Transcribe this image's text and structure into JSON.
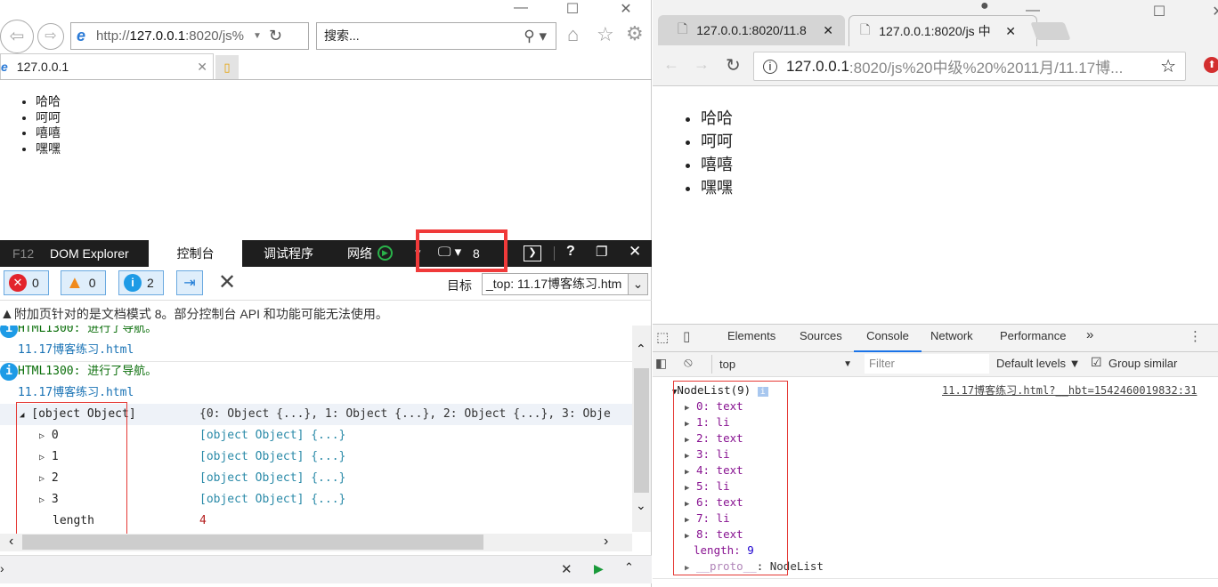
{
  "ie": {
    "window_controls": {
      "minimize": "—",
      "maximize": "☐",
      "close": "✕"
    },
    "address": {
      "prefix": "http://",
      "host": "127.0.0.1",
      "rest": ":8020/js%"
    },
    "search_placeholder": "搜索...",
    "tab_title": "127.0.0.1",
    "page_list": [
      "哈哈",
      "呵呵",
      "嘻嘻",
      "嘿嘿"
    ],
    "devtools": {
      "tabs": [
        "F12",
        "DOM Explorer",
        "控制台",
        "调试程序",
        "网络"
      ],
      "active_tab": "控制台",
      "doc_mode": "8",
      "counts": {
        "errors": "0",
        "warnings": "0",
        "info": "2"
      },
      "target_label": "目标",
      "target_value": "_top: 11.17博客练习.htm",
      "warning_text": "附加页针对的是文档模式 8。部分控制台 API 和功能可能无法使用。",
      "messages": [
        {
          "code": "HTML1300: 进行了导航。",
          "file": "11.17博客练习.html"
        },
        {
          "code": "HTML1300: 进行了导航。",
          "file": "11.17博客练习.html"
        }
      ],
      "object": {
        "label": "[object Object]",
        "summary_prefix": "{0: ",
        "summary": "{0: Object {...}, 1: Object {...}, 2: Object {...}, 3: Obje",
        "children": [
          {
            "key": "0",
            "value": "[object Object] {...}"
          },
          {
            "key": "1",
            "value": "[object Object] {...}"
          },
          {
            "key": "2",
            "value": "[object Object] {...}"
          },
          {
            "key": "3",
            "value": "[object Object] {...}"
          }
        ],
        "length_key": "length",
        "length_value": "4"
      }
    }
  },
  "chrome": {
    "tabs": [
      {
        "title": "127.0.0.1:8020/11.8"
      },
      {
        "title": "127.0.0.1:8020/js 中"
      }
    ],
    "address": {
      "host": "127.0.0.1",
      "rest": ":8020/js%20中级%20%2011月/11.17博..."
    },
    "page_list": [
      "哈哈",
      "呵呵",
      "嘻嘻",
      "嘿嘿"
    ],
    "devtools": {
      "tabs": [
        "Elements",
        "Sources",
        "Console",
        "Network",
        "Performance",
        "»"
      ],
      "active_tab": "Console",
      "context": "top",
      "filter_placeholder": "Filter",
      "levels": "Default levels ▼",
      "group_similar": "Group similar",
      "source_link": "11.17博客练习.html?__hbt=1542460019832:31",
      "nodelist_title": "NodeList(9)",
      "items": [
        {
          "key": "0",
          "value": "text"
        },
        {
          "key": "1",
          "value": "li"
        },
        {
          "key": "2",
          "value": "text"
        },
        {
          "key": "3",
          "value": "li"
        },
        {
          "key": "4",
          "value": "text"
        },
        {
          "key": "5",
          "value": "li"
        },
        {
          "key": "6",
          "value": "text"
        },
        {
          "key": "7",
          "value": "li"
        },
        {
          "key": "8",
          "value": "text"
        }
      ],
      "length_key": "length",
      "length_value": "9",
      "proto_key": "__proto__",
      "proto_value": "NodeList"
    }
  },
  "colors": {
    "highlight_red": "#e53935",
    "ie_dark": "#1e1e1e",
    "chrome_accent": "#1a73e8"
  }
}
